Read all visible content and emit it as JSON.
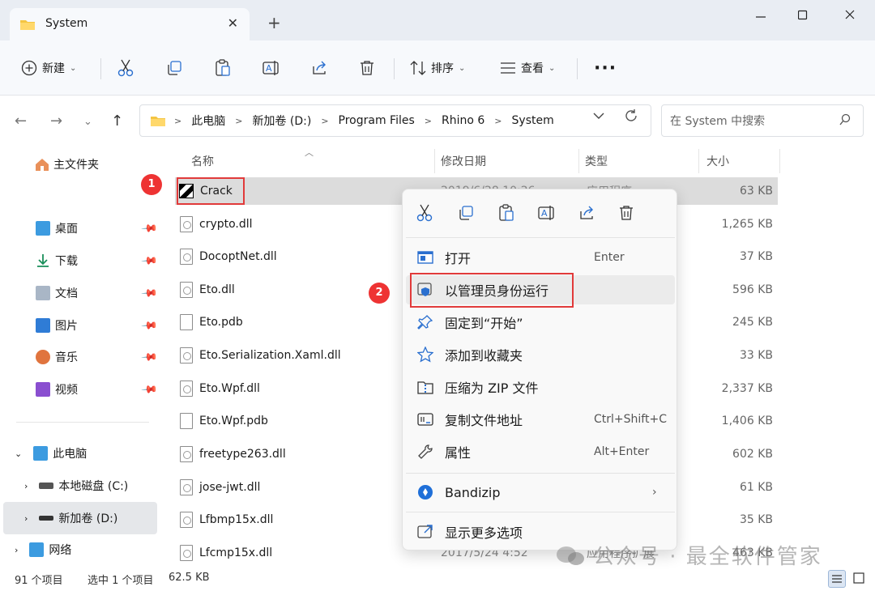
{
  "window": {
    "tab_title": "System",
    "tab_close": "✕",
    "new_tab": "+",
    "min": "—",
    "max": "☐",
    "close": "✕"
  },
  "toolbar": {
    "new_label": "新建",
    "sort_label": "排序",
    "view_label": "查看",
    "more_label": "···"
  },
  "address": {
    "crumbs": [
      "此电脑",
      "新加卷 (D:)",
      "Program Files",
      "Rhino 6",
      "System"
    ],
    "search_placeholder": "在 System 中搜索"
  },
  "sidebar": {
    "home": "主文件夹",
    "quick": [
      "桌面",
      "下载",
      "文档",
      "图片",
      "音乐",
      "视频"
    ],
    "this_pc": "此电脑",
    "drive_c": "本地磁盘 (C:)",
    "drive_d": "新加卷 (D:)",
    "network": "网络"
  },
  "columns": {
    "name": "名称",
    "date": "修改日期",
    "type": "类型",
    "size": "大小"
  },
  "files": [
    {
      "name": "Crack",
      "size": "63 KB",
      "date": "2019/6/28 10:26",
      "type": "应用程序"
    },
    {
      "name": "crypto.dll",
      "size": "1,265 KB"
    },
    {
      "name": "DocoptNet.dll",
      "size": "37 KB"
    },
    {
      "name": "Eto.dll",
      "size": "596 KB"
    },
    {
      "name": "Eto.pdb",
      "size": "245 KB"
    },
    {
      "name": "Eto.Serialization.Xaml.dll",
      "size": "33 KB"
    },
    {
      "name": "Eto.Wpf.dll",
      "size": "2,337 KB"
    },
    {
      "name": "Eto.Wpf.pdb",
      "size": "1,406 KB"
    },
    {
      "name": "freetype263.dll",
      "size": "602 KB"
    },
    {
      "name": "jose-jwt.dll",
      "size": "61 KB"
    },
    {
      "name": "Lfbmp15x.dll",
      "size": "35 KB"
    },
    {
      "name": "Lfcmp15x.dll",
      "size": "463 KB",
      "date": "2017/5/24 4:52",
      "type": "应用程序扩展"
    }
  ],
  "annotations": {
    "badge1": "1",
    "badge2": "2"
  },
  "context_menu": {
    "open": "打开",
    "open_shortcut": "Enter",
    "run_as_admin": "以管理员身份运行",
    "pin_start": "固定到“开始”",
    "add_favorites": "添加到收藏夹",
    "compress_zip": "压缩为 ZIP 文件",
    "copy_path": "复制文件地址",
    "copy_path_shortcut": "Ctrl+Shift+C",
    "properties": "属性",
    "properties_shortcut": "Alt+Enter",
    "bandizip": "Bandizip",
    "more_options": "显示更多选项"
  },
  "status": {
    "count": "91 个项目",
    "selected": "选中 1 个项目",
    "size": "62.5 KB"
  },
  "watermark": "公众号 · 最全软件管家"
}
